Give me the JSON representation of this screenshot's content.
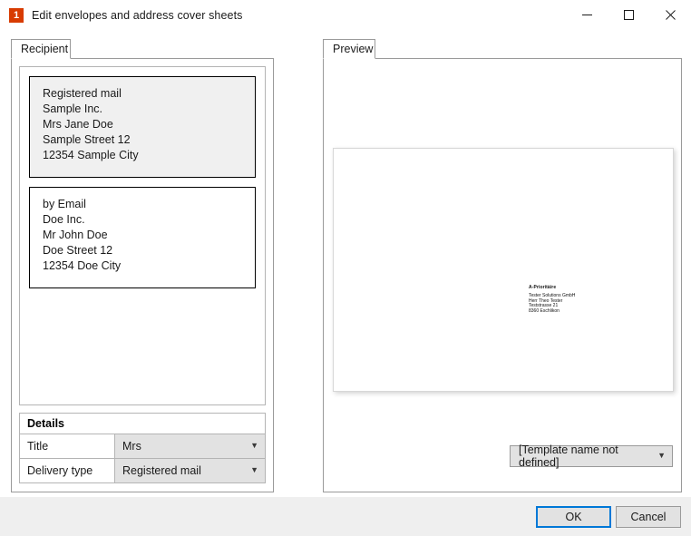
{
  "window": {
    "title": "Edit envelopes and address cover sheets",
    "icon_label": "1",
    "icon_color": "#d83b01",
    "controls": {
      "minimize": "minimize-icon",
      "maximize": "maximize-icon",
      "close": "close-icon"
    }
  },
  "recipient": {
    "tab_label": "Recipient",
    "addresses": [
      {
        "selected": true,
        "lines": [
          "Registered mail",
          "Sample Inc.",
          "Mrs Jane Doe",
          "Sample Street 12",
          "12354 Sample City"
        ]
      },
      {
        "selected": false,
        "lines": [
          "by Email",
          "Doe Inc.",
          "Mr John Doe",
          "Doe Street 12",
          "12354 Doe City"
        ]
      }
    ],
    "details": {
      "header": "Details",
      "rows": [
        {
          "label": "Title",
          "value": "Mrs"
        },
        {
          "label": "Delivery type",
          "value": "Registered mail"
        }
      ]
    }
  },
  "preview": {
    "tab_label": "Preview",
    "envelope": {
      "priority_mark": "A-Prioritàire",
      "address_lines": [
        "Tester Solutions GmbH",
        "Herr Theo Tester",
        "Teststrasse 21",
        "8360 Eschlikon"
      ]
    },
    "template_select": {
      "value": "[Template name not defined]"
    }
  },
  "footer": {
    "ok_label": "OK",
    "cancel_label": "Cancel",
    "accent_color": "#0078d7"
  }
}
